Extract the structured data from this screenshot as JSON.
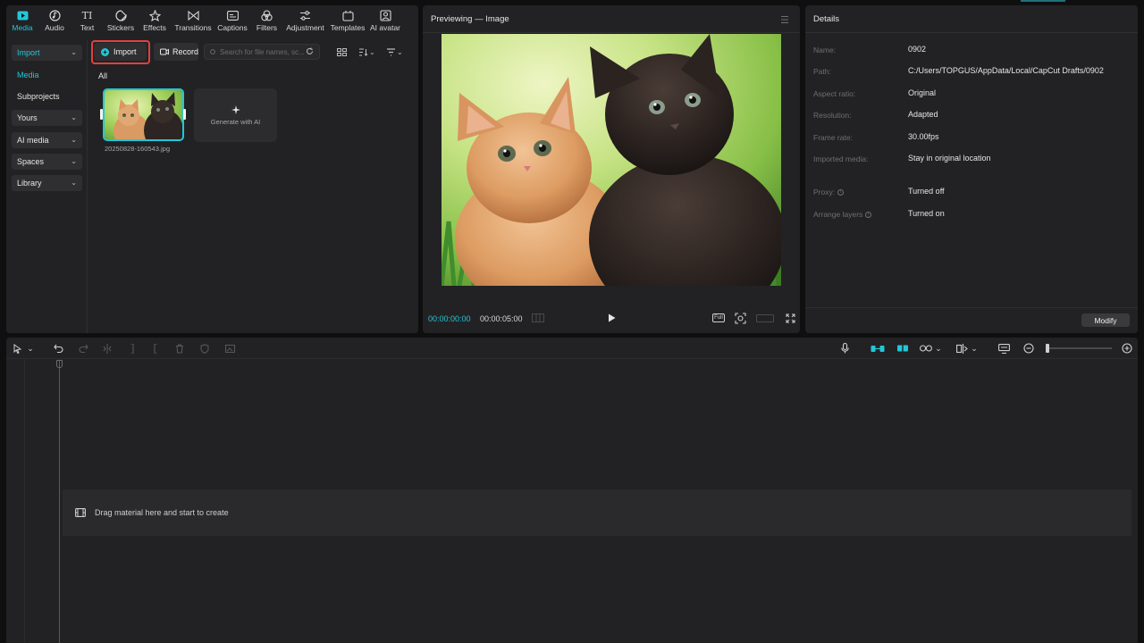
{
  "tool_tabs": [
    {
      "label": "Media",
      "icon": "media-icon",
      "active": true
    },
    {
      "label": "Audio",
      "icon": "audio-icon"
    },
    {
      "label": "Text",
      "icon": "text-icon"
    },
    {
      "label": "Stickers",
      "icon": "stickers-icon"
    },
    {
      "label": "Effects",
      "icon": "effects-icon"
    },
    {
      "label": "Transitions",
      "icon": "transitions-icon"
    },
    {
      "label": "Captions",
      "icon": "captions-icon"
    },
    {
      "label": "Filters",
      "icon": "filters-icon"
    },
    {
      "label": "Adjustment",
      "icon": "adjustment-icon"
    },
    {
      "label": "Templates",
      "icon": "templates-icon"
    },
    {
      "label": "AI avatar",
      "icon": "ai-avatar-icon"
    }
  ],
  "sidebar": {
    "items": [
      {
        "label": "Import"
      },
      {
        "label": "Media"
      },
      {
        "label": "Subprojects"
      },
      {
        "label": "Yours"
      },
      {
        "label": "AI media"
      },
      {
        "label": "Spaces"
      },
      {
        "label": "Library"
      }
    ]
  },
  "media": {
    "import_label": "Import",
    "record_label": "Record",
    "search_placeholder": "Search for file names, sc...",
    "filter_all": "All",
    "thumbnail_name": "20250828-160543.jpg",
    "generate_label": "Generate with AI"
  },
  "preview": {
    "title": "Previewing — Image",
    "time_current": "00:00:00:00",
    "time_total": "00:00:05:00",
    "full_label": "Full"
  },
  "details": {
    "title": "Details",
    "rows": [
      {
        "label": "Name:",
        "value": "0902"
      },
      {
        "label": "Path:",
        "value": "C:/Users/TOPGUS/AppData/Local/CapCut Drafts/0902"
      },
      {
        "label": "Aspect ratio:",
        "value": "Original"
      },
      {
        "label": "Resolution:",
        "value": "Adapted"
      },
      {
        "label": "Frame rate:",
        "value": "30.00fps"
      },
      {
        "label": "Imported media:",
        "value": "Stay in original location"
      },
      {
        "label": "Proxy:",
        "value": "Turned off"
      },
      {
        "label": "Arrange layers",
        "value": "Turned on"
      }
    ],
    "modify_label": "Modify"
  },
  "timeline": {
    "drop_text": "Drag material here and start to create"
  },
  "colors": {
    "accent": "#21c7d9",
    "highlight": "#e0413f",
    "panel": "#222224",
    "background": "#0f0f10"
  }
}
